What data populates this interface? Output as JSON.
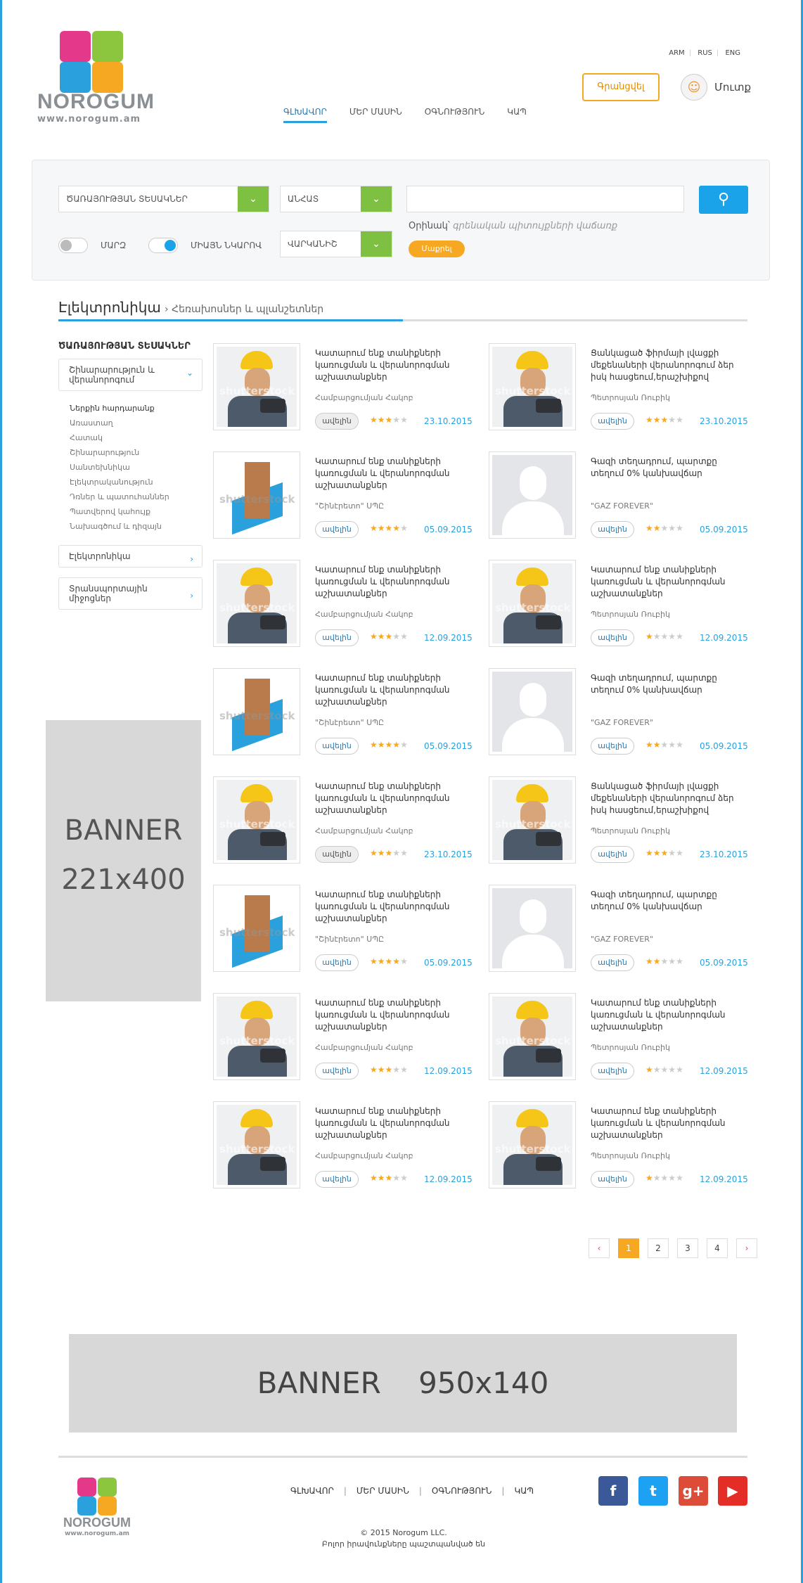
{
  "header": {
    "logo_name": "NOROGUM",
    "logo_url": "www.norogum.am",
    "languages": [
      "ARM",
      "RUS",
      "ENG"
    ],
    "register_label": "Գրանցվել",
    "login_label": "Մուտք",
    "nav": [
      "ԳԼԽԱՎՈՐ",
      "ՄԵՐ ՄԱՍԻՆ",
      "ՕԳՆՈՒԹՅՈՒՆ",
      "ԿԱՊ"
    ]
  },
  "search": {
    "category_select": "ԾԱՌԱՅՈՒԹՅԱՆ ՏԵՍԱԿՆԵՐ",
    "location_select": "ԱՆՀԱՏ",
    "region_select": "ՎԱՐԿԱՆԻՇ",
    "input_value": "",
    "example_label": "Օրինակ՝",
    "example_hint": "գրենական պիտույքների վաճառք",
    "find_label": "Մաքրել",
    "toggle1_label": "ՄԱՐԶ",
    "toggle2_label": "ՄԻԱՅՆ ՆԿԱՐՈՎ"
  },
  "breadcrumb": {
    "main": "Էլեկտրոնիկա",
    "sub": "Հեռախոսներ և պլանշետներ"
  },
  "sidebar": {
    "heading": "ԾԱՌԱՅՈՒԹՅԱՆ ՏԵՍԱԿՆԵՐ",
    "open_group": "Շինարարություն և վերանորոգում",
    "sub_items": [
      "Ներքին հարդարանք",
      "Առաստաղ",
      "Հատակ",
      "Շինարարություն",
      "Սանտեխնիկա",
      "Էլեկտրականություն",
      "Դռներ և պատուհաններ",
      "Պատվերով կահույք",
      "Նախագծում և դիզայն"
    ],
    "group2": "Էլեկտրոնիկա",
    "group3": "Տրանսպորտային միջոցներ",
    "banner": [
      "BANNER",
      "221x400"
    ]
  },
  "listings": [
    {
      "title": "Կատարում ենք տանիքների կառուցման և վերանորոգման աշխատանքներ",
      "author": "Համբարցումյան Հակոբ",
      "more": "ավելին",
      "rating": 3,
      "date": "23.10.2015",
      "img": "worker"
    },
    {
      "title": "Ցանկացած ֆիրմայի լվացքի մեքենաների վերանորոգում ձեր իսկ հասցեում,երաշխիքով",
      "author": "Պետրոսյան Ռուբիկ",
      "more": "ավելին",
      "rating": 3,
      "date": "23.10.2015",
      "img": "worker"
    },
    {
      "title": "Կատարում ենք տանիքների կառուցման և վերանորոգման աշխատանքներ",
      "author": "\"Շինէրետո\" ՍՊԸ",
      "more": "ավելին",
      "rating": 4,
      "date": "05.09.2015",
      "img": "building"
    },
    {
      "title": "Գազի տեղադրում, պարտքը տեղում 0% կանխավճար",
      "author": "\"GAZ FOREVER\"",
      "more": "ավելին",
      "rating": 2,
      "date": "05.09.2015",
      "img": "placeholder"
    },
    {
      "title": "Կատարում ենք տանիքների կառուցման և վերանորոգման աշխատանքներ",
      "author": "Համբարցումյան Հակոբ",
      "more": "ավելին",
      "rating": 3,
      "date": "12.09.2015",
      "img": "worker"
    },
    {
      "title": "Կատարում ենք տանիքների կառուցման և վերանորոգման աշխատանքներ",
      "author": "Պետրոսյան Ռուբիկ",
      "more": "ավելին",
      "rating": 1,
      "date": "12.09.2015",
      "img": "worker"
    },
    {
      "title": "Կատարում ենք տանիքների կառուցման և վերանորոգման աշխատանքներ",
      "author": "\"Շինէրետո\" ՍՊԸ",
      "more": "ավելին",
      "rating": 4,
      "date": "05.09.2015",
      "img": "building"
    },
    {
      "title": "Գազի տեղադրում, պարտքը տեղում 0% կանխավճար",
      "author": "\"GAZ FOREVER\"",
      "more": "ավելին",
      "rating": 2,
      "date": "05.09.2015",
      "img": "placeholder"
    },
    {
      "title": "Կատարում ենք տանիքների կառուցման և վերանորոգման աշխատանքներ",
      "author": "Համբարցումյան Հակոբ",
      "more": "ավելին",
      "rating": 3,
      "date": "23.10.2015",
      "img": "worker"
    },
    {
      "title": "Ցանկացած ֆիրմայի լվացքի մեքենաների վերանորոգում ձեր իսկ հասցեում,երաշխիքով",
      "author": "Պետրոսյան Ռուբիկ",
      "more": "ավելին",
      "rating": 3,
      "date": "23.10.2015",
      "img": "worker"
    },
    {
      "title": "Կատարում ենք տանիքների կառուցման և վերանորոգման աշխատանքներ",
      "author": "\"Շինէրետո\" ՍՊԸ",
      "more": "ավելին",
      "rating": 4,
      "date": "05.09.2015",
      "img": "building"
    },
    {
      "title": "Գազի տեղադրում, պարտքը տեղում 0% կանխավճար",
      "author": "\"GAZ FOREVER\"",
      "more": "ավելին",
      "rating": 2,
      "date": "05.09.2015",
      "img": "placeholder"
    },
    {
      "title": "Կատարում ենք տանիքների կառուցման և վերանորոգման աշխատանքներ",
      "author": "Համբարցումյան Հակոբ",
      "more": "ավելին",
      "rating": 3,
      "date": "12.09.2015",
      "img": "worker"
    },
    {
      "title": "Կատարում ենք տանիքների կառուցման և վերանորոգման աշխատանքներ",
      "author": "Պետրոսյան Ռուբիկ",
      "more": "ավելին",
      "rating": 1,
      "date": "12.09.2015",
      "img": "worker"
    },
    {
      "title": "Կատարում ենք տանիքների կառուցման և վերանորոգման աշխատանքներ",
      "author": "Համբարցումյան Հակոբ",
      "more": "ավելին",
      "rating": 3,
      "date": "12.09.2015",
      "img": "worker"
    },
    {
      "title": "Կատարում ենք տանիքների կառուցման և վերանորոգման աշխատանքներ",
      "author": "Պետրոսյան Ռուբիկ",
      "more": "ավելին",
      "rating": 1,
      "date": "12.09.2015",
      "img": "worker"
    }
  ],
  "watermark": "shutterstock",
  "pagination": {
    "prev": "‹",
    "pages": [
      "1",
      "2",
      "3",
      "4"
    ],
    "current": "1",
    "next": "›"
  },
  "banner2": "BANNER 950x140",
  "footer": {
    "nav": [
      "ԳԼԽԱՎՈՐ",
      "ՄԵՐ ՄԱՍԻՆ",
      "ՕԳՆՈՒԹՅՈՒՆ",
      "ԿԱՊ"
    ],
    "copyright": "© 2015 Norogum LLC.",
    "rights": "Բոլոր իրավունքները պաշտպանված են",
    "social": [
      {
        "name": "facebook",
        "glyph": "f",
        "color": "#3b5998"
      },
      {
        "name": "twitter",
        "glyph": "t",
        "color": "#1da1f2"
      },
      {
        "name": "google-plus",
        "glyph": "g+",
        "color": "#dd4b39"
      },
      {
        "name": "youtube",
        "glyph": "▶",
        "color": "#e52d27"
      }
    ]
  },
  "colors": {
    "accent": "#2aa0dd",
    "orange": "#f7a823",
    "green": "#7ec142"
  }
}
